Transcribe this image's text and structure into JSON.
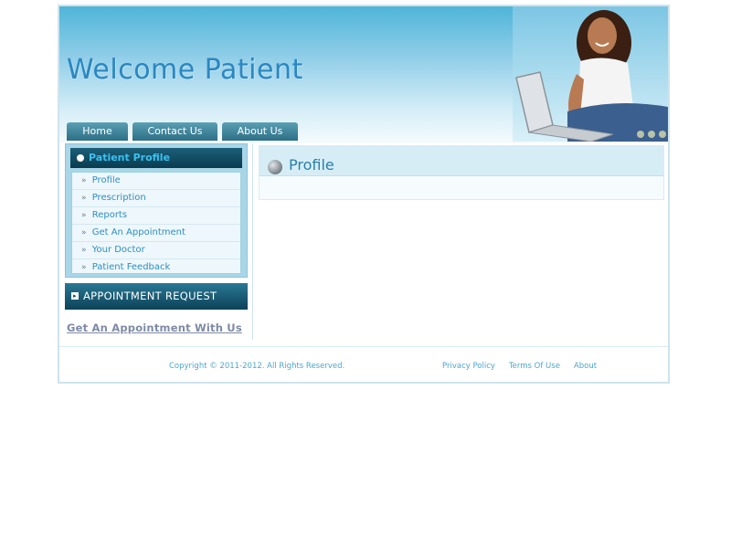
{
  "header": {
    "title": "Welcome Patient"
  },
  "nav": {
    "items": [
      {
        "label": "Home"
      },
      {
        "label": "Contact Us"
      },
      {
        "label": "About Us"
      }
    ]
  },
  "sidebar": {
    "profile_heading": "Patient Profile",
    "menu": [
      {
        "label": "Profile"
      },
      {
        "label": "Prescription"
      },
      {
        "label": "Reports"
      },
      {
        "label": "Get An Appointment"
      },
      {
        "label": "Your Doctor"
      },
      {
        "label": "Patient Feedback"
      }
    ],
    "appointment_heading": "APPOINTMENT REQUEST",
    "appointment_link": "Get An Appointment With Us"
  },
  "content": {
    "title": "Profile"
  },
  "footer": {
    "copyright": "Copyright © 2011-2012. All Rights Reserved.",
    "links": [
      {
        "label": "Privacy Policy"
      },
      {
        "label": "Terms Of Use"
      },
      {
        "label": "About"
      }
    ]
  },
  "colors": {
    "brand_blue": "#2a87c2",
    "nav_teal": "#2c6f86",
    "link_blue": "#4aa6cf"
  }
}
